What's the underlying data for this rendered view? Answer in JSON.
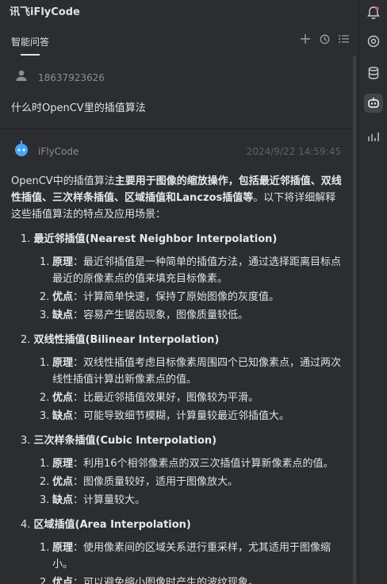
{
  "app": {
    "title": "讯飞iFlyCode"
  },
  "tabbar": {
    "tab_label": "智能问答"
  },
  "user": {
    "name": "18637923626",
    "question": "什么时OpenCV里的插值算法"
  },
  "ai": {
    "name": "iFlyCode",
    "timestamp": "2024/9/22 14:59:45",
    "intro_prefix": "OpenCV中的插值算法",
    "intro_bold": "主要用于图像的缩放操作，包括最近邻插值、双线性插值、三次样条插值、区域插值和Lanczos插值等",
    "intro_suffix": "。以下将详细解释这些插值算法的特点及应用场景：",
    "sections": [
      {
        "num": "1.",
        "title": "最近邻插值(Nearest Neighbor Interpolation)",
        "items": [
          {
            "num": "1.",
            "label": "原理",
            "text": "：最近邻插值是一种简单的插值方法，通过选择距离目标点最近的原像素点的值来填充目标像素。"
          },
          {
            "num": "2.",
            "label": "优点",
            "text": "：计算简单快速，保持了原始图像的灰度值。"
          },
          {
            "num": "3.",
            "label": "缺点",
            "text": "：容易产生锯齿现象，图像质量较低。"
          }
        ]
      },
      {
        "num": "2.",
        "title": "双线性插值(Bilinear Interpolation)",
        "items": [
          {
            "num": "1.",
            "label": "原理",
            "text": "：双线性插值考虑目标像素周围四个已知像素点，通过两次线性插值计算出新像素点的值。"
          },
          {
            "num": "2.",
            "label": "优点",
            "text": "：比最近邻插值效果好，图像较为平滑。"
          },
          {
            "num": "3.",
            "label": "缺点",
            "text": "：可能导致细节模糊，计算量较最近邻插值大。"
          }
        ]
      },
      {
        "num": "3.",
        "title": "三次样条插值(Cubic Interpolation)",
        "items": [
          {
            "num": "1.",
            "label": "原理",
            "text": "：利用16个相邻像素点的双三次插值计算新像素点的值。"
          },
          {
            "num": "2.",
            "label": "优点",
            "text": "：图像质量较好，适用于图像放大。"
          },
          {
            "num": "3.",
            "label": "缺点",
            "text": "：计算量较大。"
          }
        ]
      },
      {
        "num": "4.",
        "title": "区域插值(Area Interpolation)",
        "items": [
          {
            "num": "1.",
            "label": "原理",
            "text": "：使用像素间的区域关系进行重采样，尤其适用于图像缩小。"
          },
          {
            "num": "2.",
            "label": "优点",
            "text": "：可以避免缩小图像时产生的波纹现象。"
          }
        ]
      }
    ]
  },
  "icons": {
    "bell": "bell-icon",
    "at": "at-icon",
    "database": "database-icon",
    "bot": "bot-icon",
    "chart": "chart-icon",
    "plus": "plus-icon",
    "history": "history-icon",
    "list": "list-icon"
  },
  "colors": {
    "background": "#2b2d30",
    "text": "#dfe1e5",
    "muted": "#8a8d93",
    "accent": "#4aa3ff"
  }
}
